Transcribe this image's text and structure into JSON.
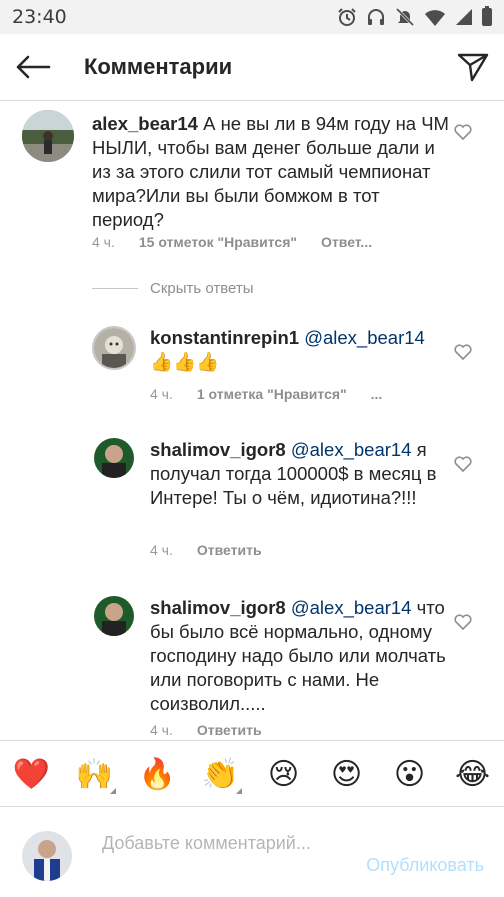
{
  "status_bar": {
    "time": "23:40",
    "icons": [
      "alarm-icon",
      "headphones-icon",
      "mute-icon",
      "wifi-icon",
      "signal-icon",
      "battery-icon"
    ]
  },
  "header": {
    "title": "Комментарии",
    "back_icon": "arrow-left-icon",
    "send_icon": "send-icon"
  },
  "comments": [
    {
      "username": "alex_bear14",
      "mention": "",
      "text": "А не вы ли в 94м году на ЧМ НЫЛИ, чтобы вам денег больше дали и из за этого слили тот самый чемпионат мира?Или вы были бомжом в тот период?",
      "time": "4 ч.",
      "likes": "15 отметок \"Нравится\"",
      "reply": "Ответ..."
    },
    {
      "username": "konstantinrepin1",
      "mention": "@alex_bear14",
      "text": "👍👍👍",
      "time": "4 ч.",
      "likes": "1 отметка \"Нравится\"",
      "reply": "..."
    },
    {
      "username": "shalimov_igor8",
      "mention": "@alex_bear14",
      "text": "я получал тогда 100000$ в месяц в Интере! Ты о чём, идиотина?!!!",
      "time": "4 ч.",
      "likes": "",
      "reply": "Ответить"
    },
    {
      "username": "shalimov_igor8",
      "mention": "@alex_bear14",
      "text": "что бы было всё нормально, одному господину надо было или молчать или поговорить с нами. Не соизволил.....",
      "time": "4 ч.",
      "likes": "",
      "reply": "Ответить"
    }
  ],
  "hide_replies": "Скрыть ответы",
  "emoji_bar": [
    "❤️",
    "🙌",
    "🔥",
    "👏",
    "😢",
    "😍",
    "😮",
    "😂"
  ],
  "compose": {
    "placeholder": "Добавьте комментарий...",
    "publish_label": "Опубликовать"
  },
  "colors": {
    "link": "#003569",
    "muted": "#8e8e8e",
    "publish_disabled": "#b2dffc",
    "divider": "#dbdbdb"
  }
}
